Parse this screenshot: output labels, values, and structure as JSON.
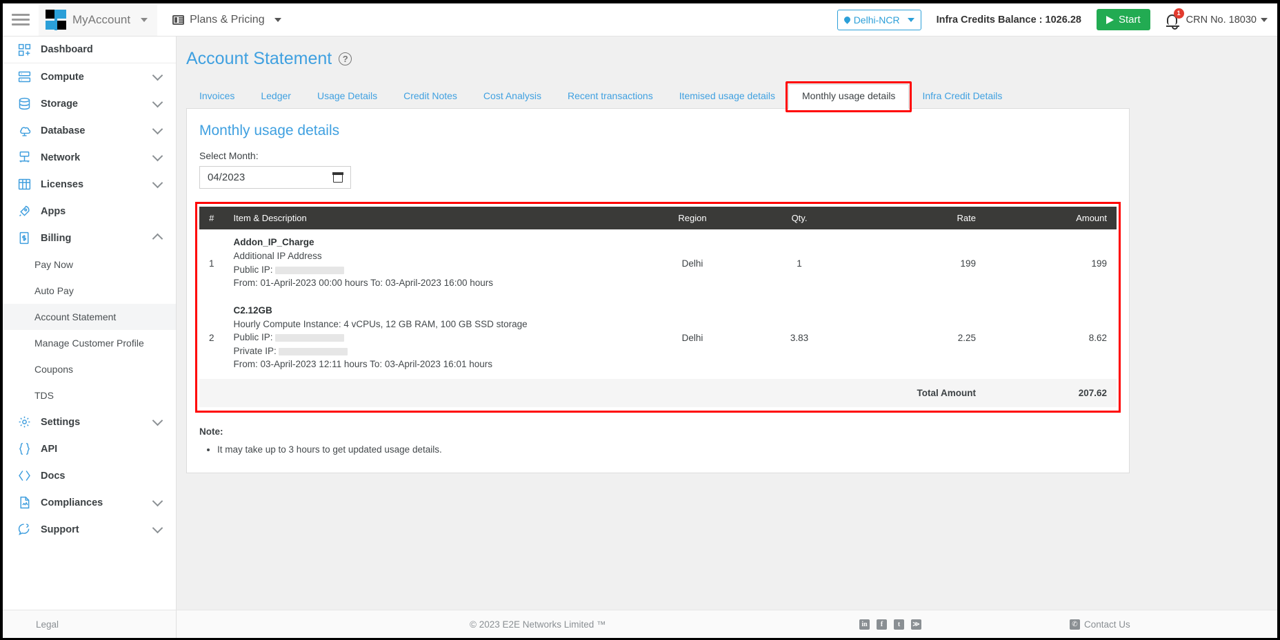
{
  "topbar": {
    "menu_icon": "hamburger-icon",
    "brand_label": "MyAccount",
    "plans_label": "Plans & Pricing",
    "region_label": "Delhi-NCR",
    "credits_label": "Infra Credits Balance : 1026.28",
    "start_label": "Start",
    "notification_count": "1",
    "crn_label": "CRN No. 18030"
  },
  "sidebar": {
    "items": [
      {
        "label": "Dashboard",
        "icon": "dashboard-icon",
        "expandable": false
      },
      {
        "label": "Compute",
        "icon": "server-icon",
        "expandable": true,
        "state": "collapsed"
      },
      {
        "label": "Storage",
        "icon": "database-cylinder-icon",
        "expandable": true,
        "state": "collapsed"
      },
      {
        "label": "Database",
        "icon": "cloud-database-icon",
        "expandable": true,
        "state": "collapsed"
      },
      {
        "label": "Network",
        "icon": "network-icon",
        "expandable": true,
        "state": "collapsed"
      },
      {
        "label": "Licenses",
        "icon": "grid-license-icon",
        "expandable": true,
        "state": "collapsed"
      },
      {
        "label": "Apps",
        "icon": "rocket-icon",
        "expandable": false
      },
      {
        "label": "Billing",
        "icon": "billing-invoice-icon",
        "expandable": true,
        "state": "expanded"
      }
    ],
    "billing_children": [
      {
        "label": "Pay Now",
        "active": false
      },
      {
        "label": "Auto Pay",
        "active": false
      },
      {
        "label": "Account Statement",
        "active": true
      },
      {
        "label": "Manage Customer Profile",
        "active": false
      },
      {
        "label": "Coupons",
        "active": false
      },
      {
        "label": "TDS",
        "active": false
      }
    ],
    "items_after": [
      {
        "label": "Settings",
        "icon": "gear-icon",
        "expandable": true,
        "state": "collapsed"
      },
      {
        "label": "API",
        "icon": "curly-braces-icon",
        "expandable": false
      },
      {
        "label": "Docs",
        "icon": "code-brackets-icon",
        "expandable": false
      },
      {
        "label": "Compliances",
        "icon": "document-icon",
        "expandable": true,
        "state": "collapsed"
      },
      {
        "label": "Support",
        "icon": "support-chat-icon",
        "expandable": true,
        "state": "collapsed"
      }
    ],
    "legal_label": "Legal"
  },
  "page": {
    "title": "Account Statement",
    "help_icon": "question-mark-icon"
  },
  "tabs": [
    {
      "label": "Invoices",
      "active": false
    },
    {
      "label": "Ledger",
      "active": false
    },
    {
      "label": "Usage Details",
      "active": false
    },
    {
      "label": "Credit Notes",
      "active": false
    },
    {
      "label": "Cost Analysis",
      "active": false
    },
    {
      "label": "Recent transactions",
      "active": false
    },
    {
      "label": "Itemised usage details",
      "active": false
    },
    {
      "label": "Monthly usage details",
      "active": true
    },
    {
      "label": "Infra Credit Details",
      "active": false
    }
  ],
  "panel": {
    "heading": "Monthly usage details",
    "select_month_label": "Select Month:",
    "month_value": "04/2023",
    "calendar_icon": "calendar-icon"
  },
  "table": {
    "columns": [
      "#",
      "Item & Description",
      "Region",
      "Qty.",
      "Rate",
      "Amount"
    ],
    "rows": [
      {
        "index": "1",
        "title": "Addon_IP_Charge",
        "description": "Additional IP Address",
        "public_ip_label": "Public IP:",
        "public_ip_value": "",
        "private_ip_label": "",
        "private_ip_value": "",
        "period": "From: 01-April-2023 00:00 hours To: 03-April-2023 16:00 hours",
        "region": "Delhi",
        "qty": "1",
        "rate": "199",
        "amount": "199"
      },
      {
        "index": "2",
        "title": "C2.12GB",
        "description": "Hourly Compute Instance: 4 vCPUs, 12 GB RAM, 100 GB SSD storage",
        "public_ip_label": "Public IP:",
        "public_ip_value": "",
        "private_ip_label": "Private IP:",
        "private_ip_value": "",
        "period": "From: 03-April-2023 12:11 hours To: 03-April-2023 16:01 hours",
        "region": "Delhi",
        "qty": "3.83",
        "rate": "2.25",
        "amount": "8.62"
      }
    ],
    "total_label": "Total Amount",
    "total_value": "207.62"
  },
  "note": {
    "heading": "Note:",
    "bullets": [
      "It may take up to 3 hours to get updated usage details."
    ]
  },
  "footer": {
    "copyright": "© 2023 E2E Networks Limited ™",
    "socials": [
      {
        "name": "linkedin-icon",
        "glyph": "in"
      },
      {
        "name": "facebook-icon",
        "glyph": "f"
      },
      {
        "name": "twitter-icon",
        "glyph": "t"
      },
      {
        "name": "rss-icon",
        "glyph": "≫"
      }
    ],
    "contact_label": "Contact Us",
    "contact_icon": "phone-icon"
  },
  "colors": {
    "accent_blue": "#3fa0e0",
    "brand_blue": "#2b9fd8",
    "start_green": "#22ab52",
    "table_header": "#3a3a38",
    "highlight_red": "#ff0000",
    "badge_red": "#e23b2e"
  }
}
